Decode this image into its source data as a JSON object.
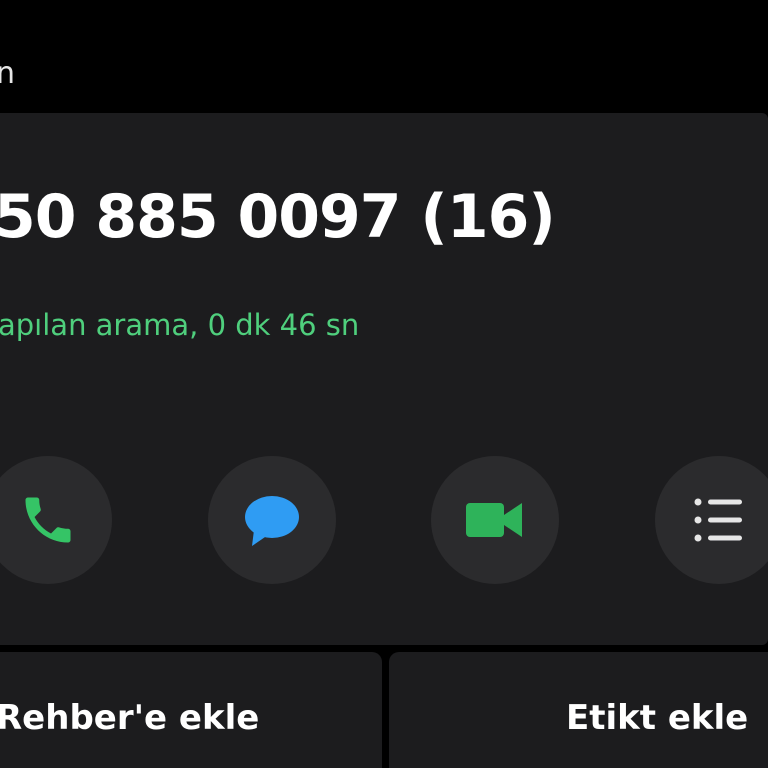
{
  "header": {
    "title": "n"
  },
  "contact": {
    "phone_number": "50 885 0097 (16)",
    "call_detail": "apılan arama, 0 dk 46 sn",
    "stray_mark": ","
  },
  "actions": [
    {
      "name": "call",
      "icon": "phone-icon",
      "color": "#35c466"
    },
    {
      "name": "message",
      "icon": "message-icon",
      "color": "#2f9cf3"
    },
    {
      "name": "video-call",
      "icon": "video-icon",
      "color": "#2eb35a"
    },
    {
      "name": "history",
      "icon": "list-icon",
      "color": "#e6e6e6"
    }
  ],
  "bottom_buttons": {
    "add_contact": "Rehber'e ekle",
    "add_tag": "Etikt ekle"
  },
  "colors": {
    "background": "#000000",
    "card": "#1c1c1e",
    "button_circle": "#2b2b2d",
    "accent_green_text": "#4fcf7d",
    "primary_text": "#ffffff"
  }
}
